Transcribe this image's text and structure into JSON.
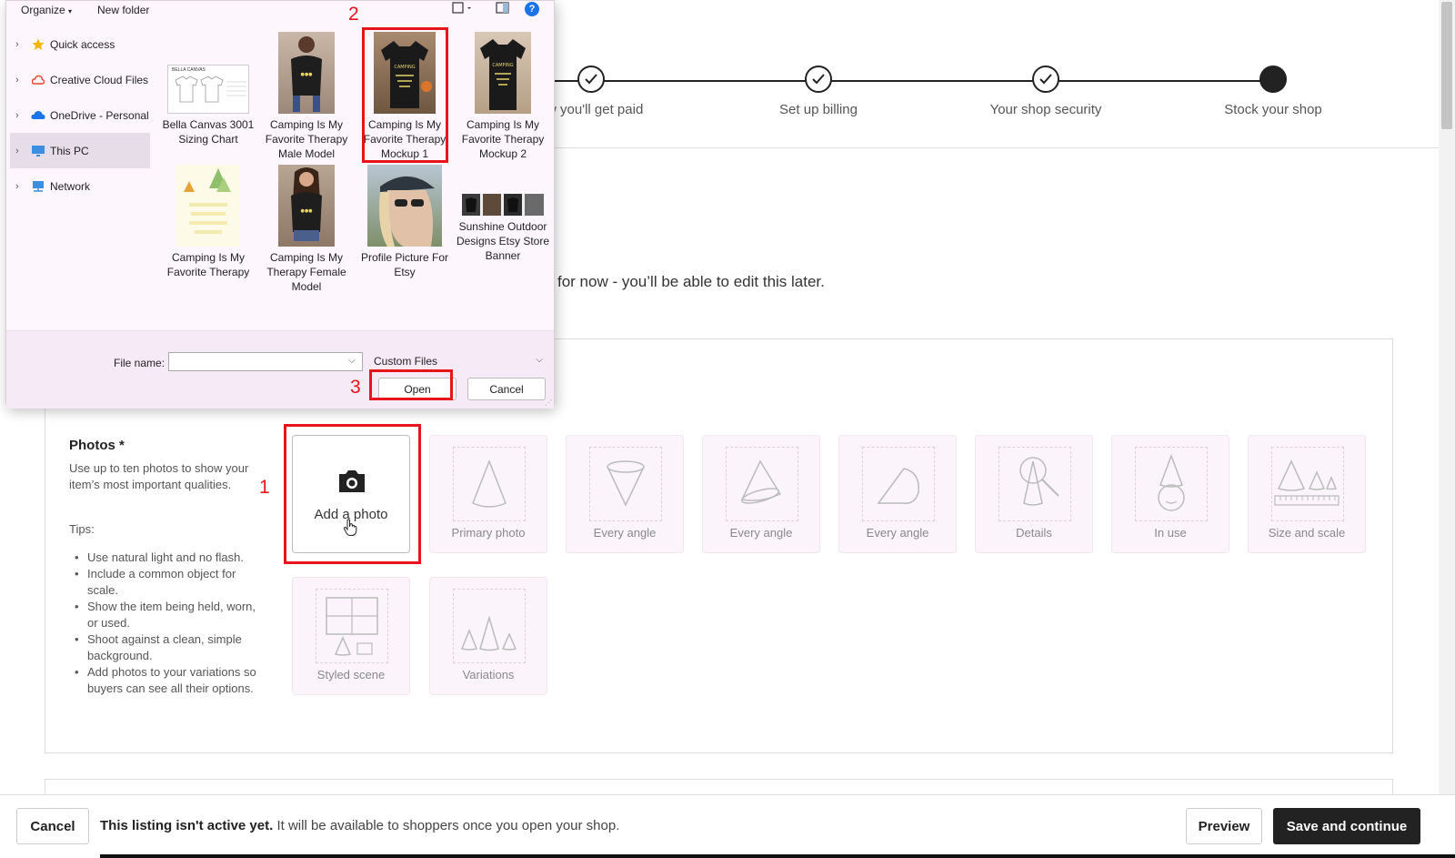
{
  "progress": {
    "steps": [
      {
        "label": "ow you'll get paid",
        "state": "done"
      },
      {
        "label": "Set up billing",
        "state": "done"
      },
      {
        "label": "Your shop security",
        "state": "done"
      },
      {
        "label": "Stock your shop",
        "state": "current"
      }
    ]
  },
  "edit_note": "for now - you’ll be able to edit this later.",
  "photos": {
    "title": "Photos *",
    "description": "Use up to ten photos to show your item’s most important qualities.",
    "tips_title": "Tips:",
    "tips": [
      "Use natural light and no flash.",
      "Include a common object for scale.",
      "Show the item being held, worn, or used.",
      "Shoot against a clean, simple background.",
      "Add photos to your variations so buyers can see all their options."
    ],
    "add_photo_label": "Add a photo",
    "tiles": [
      {
        "label": "Primary photo",
        "icon": "cone-icon"
      },
      {
        "label": "Every angle",
        "icon": "cone-top-icon"
      },
      {
        "label": "Every angle",
        "icon": "cone-side-icon"
      },
      {
        "label": "Every angle",
        "icon": "cone-lying-icon"
      },
      {
        "label": "Details",
        "icon": "magnifier-cone-icon"
      },
      {
        "label": "In use",
        "icon": "cone-hat-icon"
      },
      {
        "label": "Size and scale",
        "icon": "cones-ruler-icon"
      },
      {
        "label": "Styled scene",
        "icon": "window-scene-icon"
      },
      {
        "label": "Variations",
        "icon": "three-cones-icon"
      }
    ]
  },
  "bottom_bar": {
    "cancel_label": "Cancel",
    "note_bold": "This listing isn't active yet.",
    "note_rest": " It will be available to shoppers once you open your shop.",
    "preview_label": "Preview",
    "save_label": "Save and continue"
  },
  "annotations": {
    "one": "1",
    "two": "2",
    "three": "3"
  },
  "dialog": {
    "toolbar": {
      "organize": "Organize",
      "new_folder": "New folder",
      "help": "?"
    },
    "nav": [
      {
        "label": "Quick access",
        "icon": "star-icon"
      },
      {
        "label": "Creative Cloud Files",
        "icon": "creative-cloud-icon"
      },
      {
        "label": "OneDrive - Personal",
        "icon": "cloud-icon"
      },
      {
        "label": "This PC",
        "icon": "monitor-icon",
        "selected": true
      },
      {
        "label": "Network",
        "icon": "network-icon"
      }
    ],
    "files": [
      {
        "name": "Bella Canvas 3001 Sizing Chart",
        "thumb_text": "BELLA CANVAS"
      },
      {
        "name": "Camping Is My Favorite Therapy Male Model"
      },
      {
        "name": "Camping Is My Favorite Therapy Mockup 1",
        "selected": true,
        "thumb_text": "CAMPING"
      },
      {
        "name": "Camping Is My Favorite Therapy Mockup 2",
        "thumb_text": "CAMPING"
      },
      {
        "name": "Camping Is My Favorite Therapy"
      },
      {
        "name": "Camping Is My Therapy Female Model"
      },
      {
        "name": "Profile Picture For Etsy"
      },
      {
        "name": "Sunshine Outdoor Designs Etsy Store Banner"
      }
    ],
    "filename_label": "File name:",
    "filename_value": "",
    "filetype_value": "Custom Files",
    "open_label": "Open",
    "cancel_label": "Cancel"
  },
  "colors": {
    "accent": "#222222",
    "annotation_red": "#e8141b",
    "dialog_bg": "#fdf6fd",
    "tile_bg": "#fbf5fb"
  }
}
